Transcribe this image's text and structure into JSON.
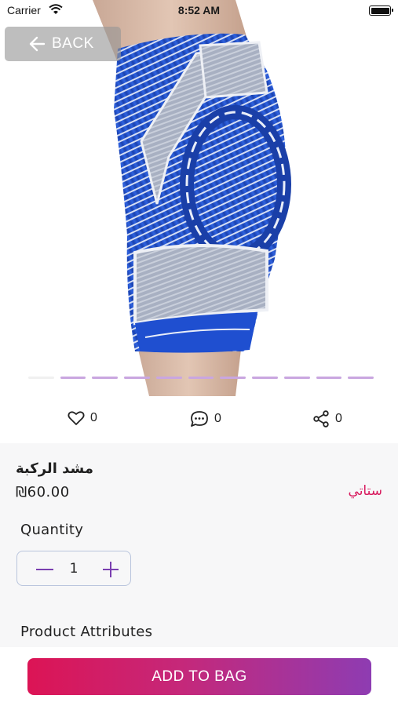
{
  "status_bar": {
    "carrier": "Carrier",
    "time": "8:52 AM"
  },
  "header": {
    "back_label": "BACK"
  },
  "gallery": {
    "image_subject": "knee-brace-product-photo",
    "page_count": 11,
    "active_page": 1
  },
  "social": {
    "likes_count": "0",
    "comments_count": "0",
    "shares_count": "0"
  },
  "product": {
    "name": "مشد الركبة",
    "price": "₪60.00",
    "seller": "ستاتي"
  },
  "quantity": {
    "label": "Quantity",
    "value": "1"
  },
  "attributes": {
    "label": "Product Attributes"
  },
  "footer": {
    "add_to_bag_label": "ADD TO BAG"
  },
  "colors": {
    "accent_pink": "#d81b5e",
    "accent_purple": "#8e3cb2",
    "stepper_icon": "#7a3fb0"
  }
}
